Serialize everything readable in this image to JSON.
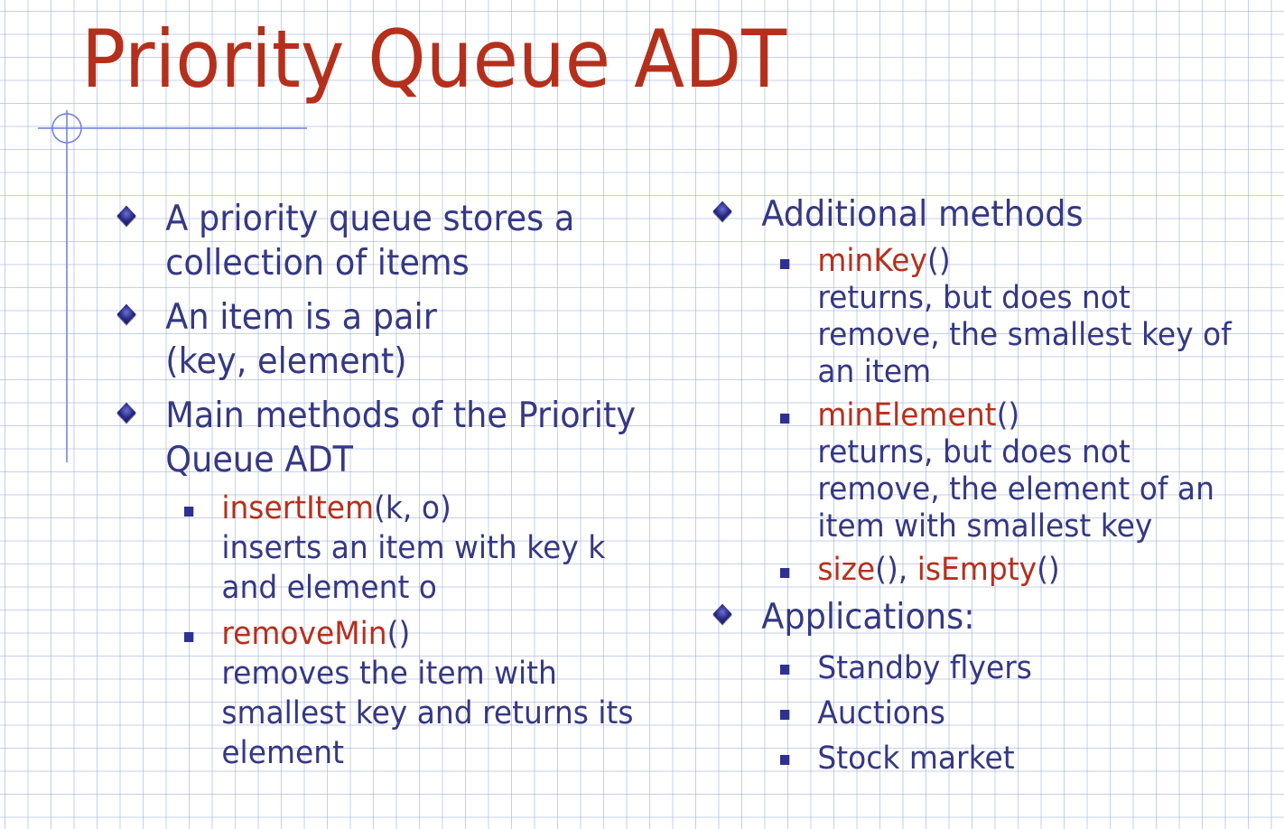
{
  "title": "Priority Queue ADT",
  "colors": {
    "title": "#b5301c",
    "text": "#353883",
    "highlight": "#b5301c",
    "grid": "#96aad7"
  },
  "left": {
    "b1": "A priority queue stores a collection of items",
    "b1_l1": "A priority queue stores a",
    "b1_l2": "collection of items",
    "b2_l1": "An item is a pair",
    "b2_l2": "(key, element)",
    "b3_l1": "Main methods of the Priority",
    "b3_l2": "Queue ADT",
    "m1_name": "insertItem",
    "m1_args": "(k, o)",
    "m1_d1": "inserts an item with key k",
    "m1_d2": "and element o",
    "m2_name": "removeMin",
    "m2_args": "()",
    "m2_d1": "removes the item with",
    "m2_d2": "smallest key and returns its",
    "m2_d3": "element"
  },
  "right": {
    "b1": "Additional methods",
    "m1_name": "minKey",
    "m1_args": "()",
    "m1_d1": "returns, but does not",
    "m1_d2": "remove, the smallest key of",
    "m1_d3": "an item",
    "m2_name": "minElement",
    "m2_args": "()",
    "m2_d1": "returns, but does not",
    "m2_d2": "remove, the element of an",
    "m2_d3": "item with smallest key",
    "m3_name1": "size",
    "m3_mid": "(), ",
    "m3_name2": "isEmpty",
    "m3_args": "()",
    "b2": "Applications:",
    "apps": [
      "Standby flyers",
      "Auctions",
      "Stock market"
    ]
  }
}
